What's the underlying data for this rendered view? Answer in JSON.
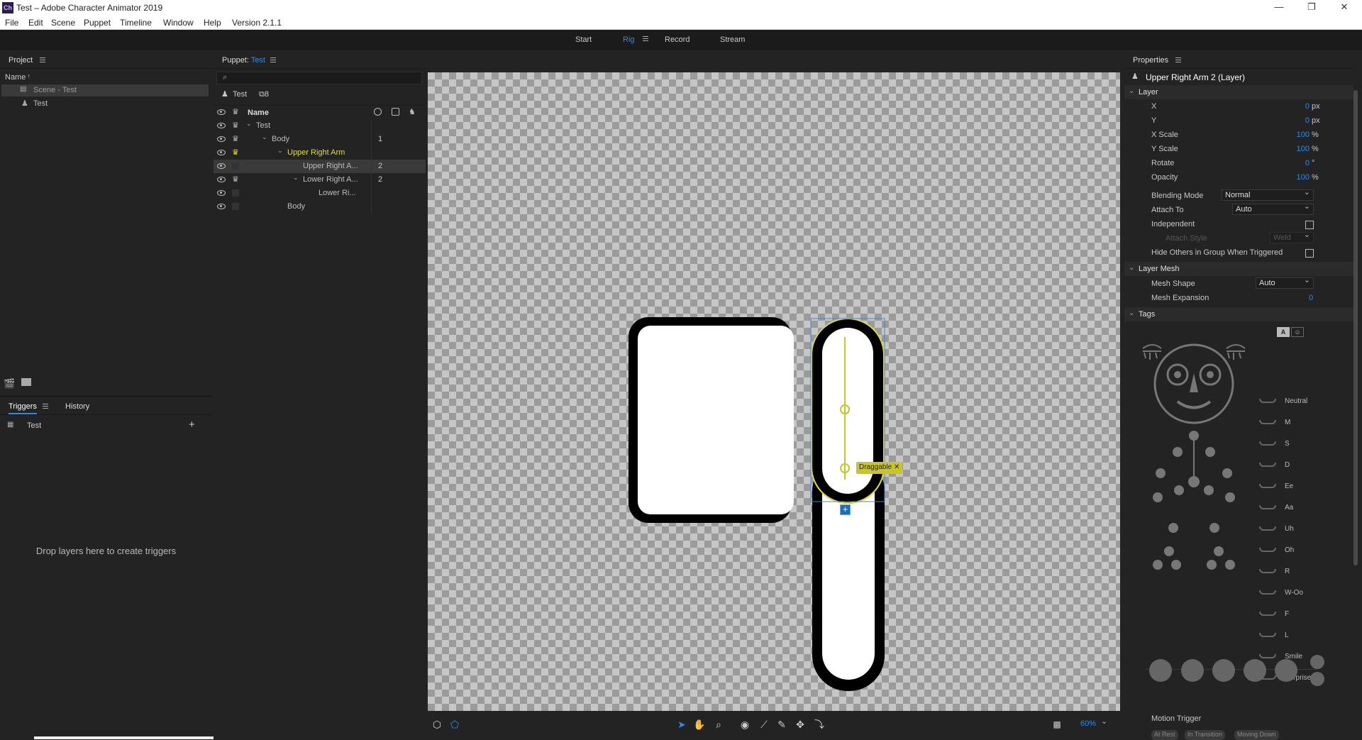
{
  "window": {
    "title": "Test – Adobe Character Animator 2019",
    "app_icon": "Ch"
  },
  "menu": [
    "File",
    "Edit",
    "Scene",
    "Puppet",
    "Timeline",
    "Window",
    "Help",
    "Version 2.1.1"
  ],
  "modes": [
    "Start",
    "Rig",
    "Record",
    "Stream"
  ],
  "active_mode": "Rig",
  "project": {
    "title": "Project",
    "column": "Name",
    "items": [
      {
        "label": "Scene - Test",
        "selected": true
      },
      {
        "label": "Test",
        "selected": false
      }
    ]
  },
  "triggers": {
    "tabs": [
      "Triggers",
      "History"
    ],
    "item": "Test",
    "empty_text": "Drop layers here to create triggers"
  },
  "puppet": {
    "title_prefix": "Puppet: ",
    "title_name": "Test",
    "root_label": "Test",
    "count": "8",
    "column": "Name",
    "rows": [
      {
        "label": "Test",
        "num": "",
        "indent": 0,
        "chevron": true,
        "selected": false,
        "highlight": false
      },
      {
        "label": "Body",
        "num": "1",
        "indent": 1,
        "chevron": true,
        "selected": false,
        "highlight": false
      },
      {
        "label": "Upper Right Arm",
        "num": "",
        "indent": 2,
        "chevron": true,
        "selected": false,
        "highlight": true
      },
      {
        "label": "Upper Right A...",
        "num": "2",
        "indent": 3,
        "chevron": false,
        "selected": true,
        "highlight": false
      },
      {
        "label": "Lower Right A...",
        "num": "2",
        "indent": 3,
        "chevron": true,
        "selected": false,
        "highlight": false
      },
      {
        "label": "Lower Ri...",
        "num": "",
        "indent": 4,
        "chevron": false,
        "selected": false,
        "highlight": false
      },
      {
        "label": "Body",
        "num": "",
        "indent": 2,
        "chevron": false,
        "selected": false,
        "highlight": false
      }
    ]
  },
  "canvas": {
    "draggable_label": "Draggable",
    "zoom": "60%"
  },
  "properties": {
    "title": "Properties",
    "layer_name": "Upper Right Arm 2 (Layer)",
    "layer_section": "Layer",
    "fields": [
      {
        "label": "X",
        "value": "0",
        "unit": "px"
      },
      {
        "label": "Y",
        "value": "0",
        "unit": "px"
      },
      {
        "label": "X Scale",
        "value": "100",
        "unit": "%"
      },
      {
        "label": "Y Scale",
        "value": "100",
        "unit": "%"
      },
      {
        "label": "Rotate",
        "value": "0",
        "unit": "°"
      },
      {
        "label": "Opacity",
        "value": "100",
        "unit": "%"
      }
    ],
    "blending_mode_label": "Blending Mode",
    "blending_mode": "Normal",
    "attach_to_label": "Attach To",
    "attach_to": "Auto",
    "independent_label": "Independent",
    "attach_style_label": "Attach Style",
    "attach_style": "Weld",
    "hide_others_label": "Hide Others in Group When Triggered",
    "mesh_section": "Layer Mesh",
    "mesh_shape_label": "Mesh Shape",
    "mesh_shape": "Auto",
    "mesh_expansion_label": "Mesh Expansion",
    "mesh_expansion": "0",
    "tags_section": "Tags",
    "mouth_tags": [
      "Neutral",
      "M",
      "S",
      "D",
      "Ee",
      "Aa",
      "Uh",
      "Oh",
      "R",
      "W-Oo",
      "F",
      "L",
      "Smile",
      "Surprised"
    ],
    "motion_trigger_label": "Motion Trigger",
    "motion_tags": [
      "At Rest",
      "In Transition",
      "Moving Down"
    ]
  },
  "colors": {
    "accent": "#2d8ceb",
    "highlight": "#e5df3a",
    "handle": "#c9c42a"
  }
}
